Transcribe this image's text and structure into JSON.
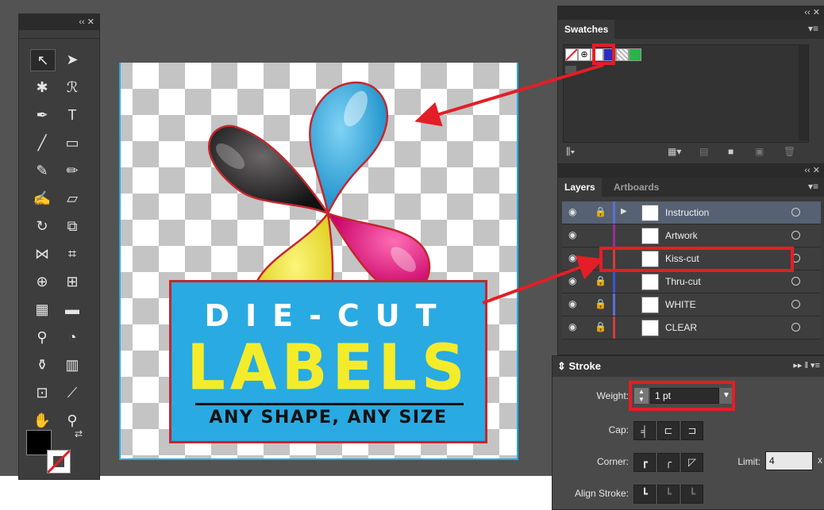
{
  "tools_panel": {
    "collapse_glyph": "‹‹ ✕",
    "tools": [
      "selection-tool",
      "direct-selection-tool",
      "magic-wand-tool",
      "lasso-tool",
      "pen-tool",
      "type-tool",
      "line-tool",
      "rectangle-tool",
      "paintbrush-tool",
      "pencil-tool",
      "blob-brush-tool",
      "eraser-tool",
      "rotate-tool",
      "scale-tool",
      "width-tool",
      "free-transform-tool",
      "shape-builder-tool",
      "perspective-grid-tool",
      "mesh-tool",
      "gradient-tool",
      "eyedropper-tool",
      "blend-tool",
      "symbol-sprayer-tool",
      "column-graph-tool",
      "artboard-tool",
      "slice-tool",
      "hand-tool",
      "zoom-tool"
    ],
    "type_label": "T"
  },
  "artwork": {
    "line1": "DIE-CUT",
    "line2": "LABELS",
    "line3": "ANY SHAPE, ANY SIZE",
    "colors": {
      "cyan": "#29aae2",
      "magenta": "#e6117a",
      "yellow": "#f4ec2a",
      "black": "#231f20",
      "outline": "#c4262e"
    }
  },
  "swatches_panel": {
    "header_glyph": "‹‹ ✕",
    "tab": "Swatches",
    "swatches": [
      "none",
      "registration",
      "white",
      "blue",
      "transparent-checker",
      "green"
    ]
  },
  "layers_panel": {
    "header_glyph": "‹‹ ✕",
    "tabs": [
      "Layers",
      "Artboards"
    ],
    "layers": [
      {
        "name": "Instruction",
        "locked": true,
        "expanded": true,
        "color": "#5a6fd6",
        "selected": true
      },
      {
        "name": "Artwork",
        "locked": false,
        "expanded": false,
        "color": "#9b2c9b",
        "selected": false
      },
      {
        "name": "Kiss-cut",
        "locked": false,
        "expanded": false,
        "color": "#d53a3a",
        "selected": false
      },
      {
        "name": "Thru-cut",
        "locked": true,
        "expanded": false,
        "color": "#3a55d5",
        "selected": false
      },
      {
        "name": "WHITE",
        "locked": true,
        "expanded": false,
        "color": "#5a6fd6",
        "selected": false
      },
      {
        "name": "CLEAR",
        "locked": true,
        "expanded": false,
        "color": "#d53a3a",
        "selected": false
      }
    ]
  },
  "stroke_panel": {
    "title": "Stroke",
    "weight_label": "Weight:",
    "weight_value": "1 pt",
    "cap_label": "Cap:",
    "corner_label": "Corner:",
    "limit_label": "Limit:",
    "limit_value": "4",
    "limit_suffix": "x",
    "align_label": "Align Stroke:"
  },
  "annotation_color": "#e41e26"
}
